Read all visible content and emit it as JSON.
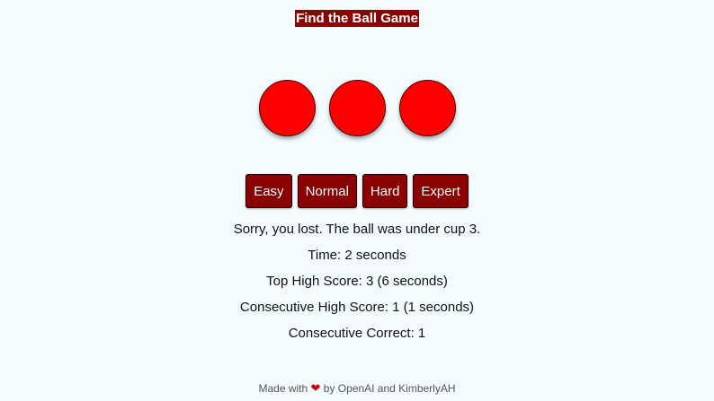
{
  "title": "Find the Ball Game",
  "cups": [
    {
      "label": "cup 1"
    },
    {
      "label": "cup 2"
    },
    {
      "label": "cup 3"
    }
  ],
  "levels": [
    "Easy",
    "Normal",
    "Hard",
    "Expert"
  ],
  "stats": {
    "result": "Sorry, you lost. The ball was under cup 3.",
    "time": "Time: 2 seconds",
    "top_high_score": "Top High Score: 3 (6 seconds)",
    "consecutive_high_score": "Consecutive High Score: 1 (1 seconds)",
    "consecutive_correct": "Consecutive Correct: 1"
  },
  "footer": {
    "made_with": "Made with",
    "heart": "❤",
    "by": "by OpenAI and KimberlyAH"
  },
  "colors": {
    "background": "#f3fbff",
    "accent": "#8b0000",
    "cup": "#ff0000"
  }
}
